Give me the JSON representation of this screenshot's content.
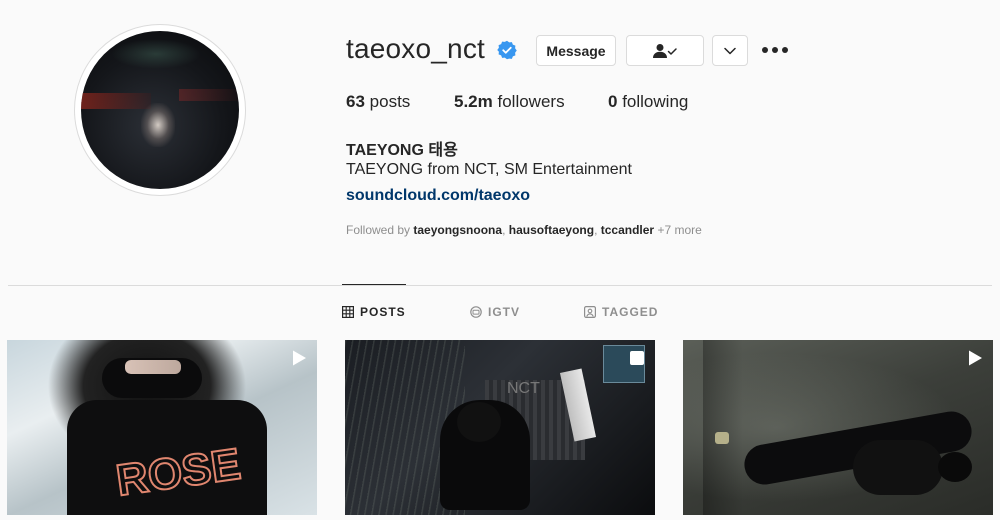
{
  "profile": {
    "username": "taeoxo_nct",
    "full_name": "TAEYONG 태용",
    "bio": "TAEYONG from NCT, SM Entertainment",
    "link": "soundcloud.com/taeoxo",
    "verified": true
  },
  "actions": {
    "message_label": "Message",
    "follow_icon": "person-check-icon",
    "dropdown_icon": "chevron-down-icon",
    "more_icon": "more-horizontal-icon"
  },
  "stats": {
    "posts_count": "63",
    "posts_label": "posts",
    "followers_count": "5.2m",
    "followers_label": "followers",
    "following_count": "0",
    "following_label": "following"
  },
  "followed_by": {
    "prefix": "Followed by",
    "accounts": [
      "taeyongsnoona",
      "hausoftaeyong",
      "tccandler"
    ],
    "more": "+7 more"
  },
  "tabs": [
    {
      "label": "POSTS",
      "icon": "grid-icon",
      "active": true
    },
    {
      "label": "IGTV",
      "icon": "igtv-icon",
      "active": false
    },
    {
      "label": "TAGGED",
      "icon": "tagged-icon",
      "active": false
    }
  ],
  "posts": [
    {
      "type": "video",
      "overlay_text": "ROSE"
    },
    {
      "type": "video",
      "overlay_text": "NCT"
    },
    {
      "type": "video"
    }
  ],
  "colors": {
    "accent_link": "#00376b",
    "verified_blue": "#3897f0",
    "background": "#fafafa",
    "border": "#dbdbdb",
    "muted_text": "#8e8e8e"
  }
}
